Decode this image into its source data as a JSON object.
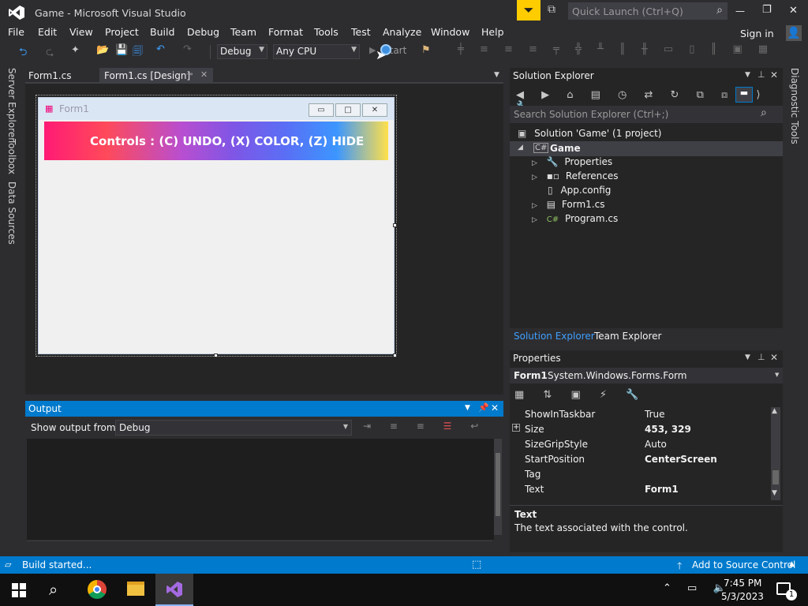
{
  "window": {
    "title": "Game - Microsoft Visual Studio",
    "quick_launch_placeholder": "Quick Launch (Ctrl+Q)",
    "min": "—",
    "max": "❐",
    "close": "✕",
    "sign_in": "Sign in"
  },
  "menu": [
    "File",
    "Edit",
    "View",
    "Project",
    "Build",
    "Debug",
    "Team",
    "Format",
    "Tools",
    "Test",
    "Analyze",
    "Window",
    "Help"
  ],
  "toolbar": {
    "config": "Debug",
    "platform": "Any CPU",
    "start_label": "Start"
  },
  "doc_tabs": [
    {
      "label": "Form1.cs"
    },
    {
      "label": "Form1.cs [Design]"
    }
  ],
  "side_tabs": [
    "Server Explorer",
    "Toolbox",
    "Data Sources"
  ],
  "right_side_tab": "Diagnostic Tools",
  "form": {
    "title": "Form1",
    "banner_text": "Controls :  (C) UNDO, (X) COLOR, (Z) HIDE"
  },
  "output": {
    "title": "Output",
    "show_label": "Show output from:",
    "source": "Debug"
  },
  "solution_explorer": {
    "title": "Solution Explorer",
    "search_placeholder": "Search Solution Explorer (Ctrl+;)",
    "solution": "Solution 'Game' (1 project)",
    "project": "Game",
    "items": [
      "Properties",
      "References",
      "App.config",
      "Form1.cs",
      "Program.cs"
    ],
    "tabs": [
      "Solution Explorer",
      "Team Explorer"
    ]
  },
  "properties": {
    "title": "Properties",
    "object": "Form1",
    "object_type": "System.Windows.Forms.Form",
    "rows": [
      {
        "name": "ShowInTaskbar",
        "value": "True"
      },
      {
        "name": "Size",
        "value": "453, 329"
      },
      {
        "name": "SizeGripStyle",
        "value": "Auto"
      },
      {
        "name": "StartPosition",
        "value": "CenterScreen"
      },
      {
        "name": "Tag",
        "value": ""
      },
      {
        "name": "Text",
        "value": "Form1"
      }
    ],
    "desc_title": "Text",
    "desc_text": "The text associated with the control."
  },
  "status": {
    "left": "Build started...",
    "right": "Add to Source Control"
  },
  "taskbar": {
    "time": "7:45 PM",
    "date": "5/3/2023",
    "notif_count": "1"
  },
  "colors": {
    "accent": "#007acc",
    "chrome": "#2d2d30",
    "panel": "#252526"
  }
}
